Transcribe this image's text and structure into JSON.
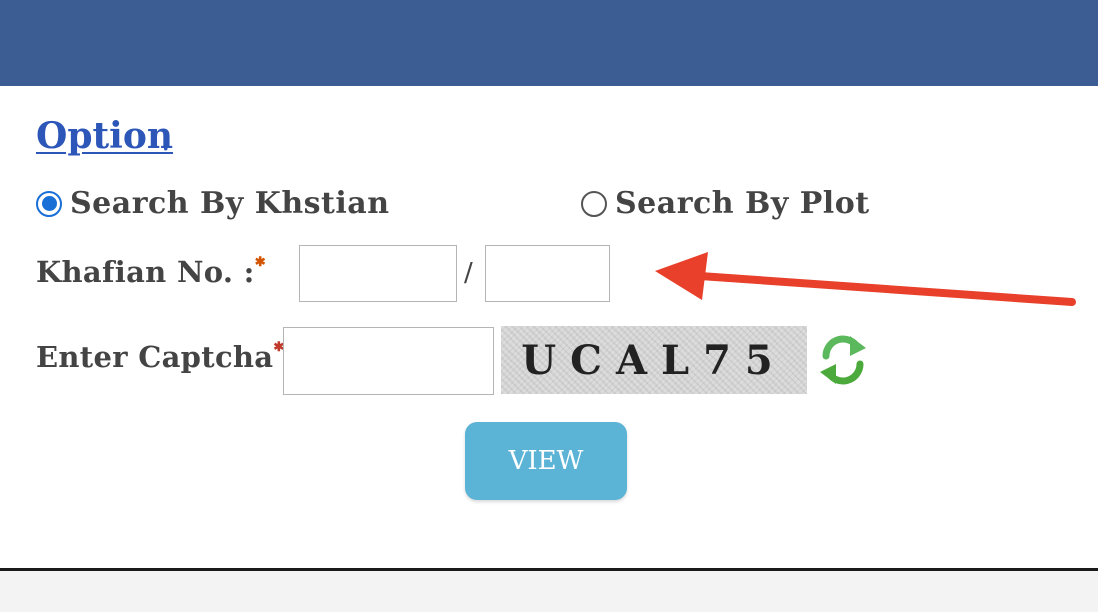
{
  "form": {
    "option_title": "Option",
    "option_colon": ":",
    "radio_khatian_label": "Search By Khstian",
    "radio_plot_label": "Search By Plot",
    "selected_option": "khatian",
    "khatian_label": "Khafian No. :",
    "khatian_part1_value": "",
    "khatian_part2_value": "",
    "slash": "/",
    "captcha_label": "Enter Captcha",
    "captcha_input_value": "",
    "captcha_text": "UCAL75",
    "view_label": "VIEW"
  },
  "icons": {
    "refresh": "refresh-icon",
    "annotation": "red-arrow-icon"
  },
  "colors": {
    "header": "#3b5d93",
    "title": "#2c56b8",
    "radio_checked": "#1a6fd6",
    "button": "#5bb3d6",
    "arrow": "#e8402a",
    "refresh": "#5cb85c"
  }
}
